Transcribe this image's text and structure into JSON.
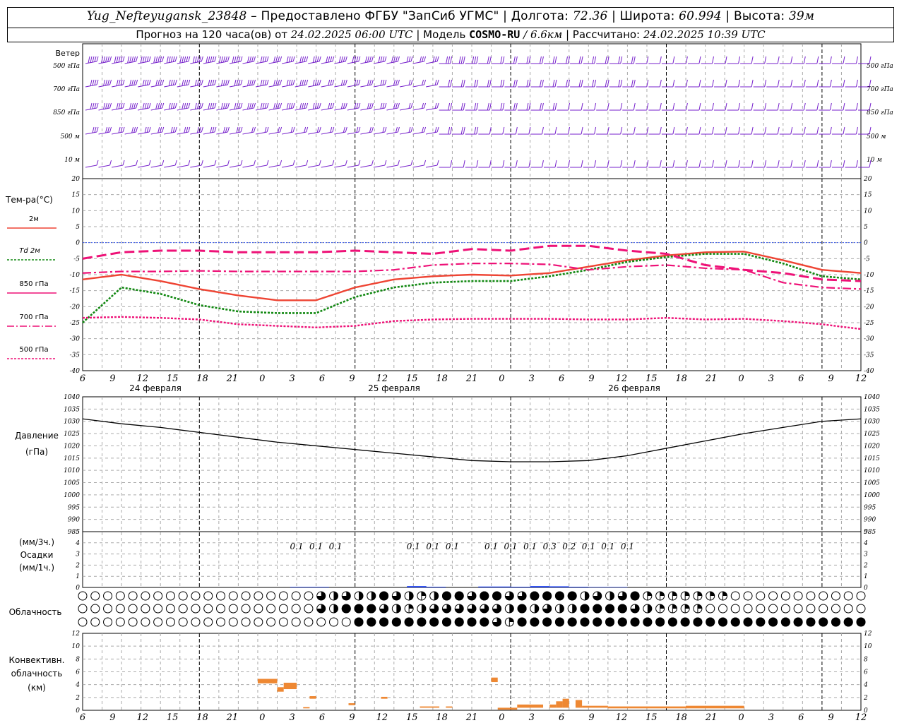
{
  "header": {
    "station": "Yug_Nefteyugansk_23848",
    "dash": " – ",
    "provided": "Предоставлено ФГБУ \"ЗапСиб УГМС\"",
    "sep": " | ",
    "lon_label": "Долгота:",
    "lon": "72.36",
    "lat_label": "Широта:",
    "lat": "60.994",
    "alt_label": "Высота:",
    "alt": "39м",
    "forecast_label": "Прогноз на 120 часа(ов) от",
    "run": "24.02.2025 06:00 UTC",
    "model_label": "Модель",
    "model": "COSMO-RU",
    "resolution": "/ 6.6км",
    "calc_label": "Рассчитано:",
    "calc": "24.02.2025 10:39 UTC"
  },
  "time_axis": {
    "ticks": [
      "6",
      "9",
      "12",
      "15",
      "18",
      "21",
      "0",
      "3",
      "6",
      "9",
      "12",
      "15",
      "18",
      "21",
      "0",
      "3",
      "6",
      "9",
      "12",
      "15",
      "18",
      "21",
      "0",
      "3",
      "6",
      "9",
      "12"
    ],
    "dates": [
      "24 февраля",
      "25 февраля",
      "26 февраля"
    ]
  },
  "labels": {
    "wind_title": "Ветер",
    "wind_levels": [
      "500 гПа",
      "700 гПа",
      "850 гПа",
      "500 м",
      "10 м"
    ],
    "temp_title": "Тем-ра(°С)",
    "temp_legend": [
      "2м",
      "Td  2м",
      "850 гПа",
      "700 гПа",
      "500 гПа"
    ],
    "pres_title": "Давление",
    "pres_unit": "(гПа)",
    "precip_unit3": "(мм/3ч.)",
    "precip_title": "Осадки",
    "precip_unit1": "(мм/1ч.)",
    "cloud_title": "Облачность",
    "conv_title": "Конвективн.",
    "conv_title2": "облачность",
    "conv_unit": "(км)"
  },
  "colors": {
    "t2m": "#ee4433",
    "td2m": "#118811",
    "t850": "#ee1177",
    "t700": "#ee1177",
    "t500": "#ee1177",
    "wind": "#7722cc",
    "pressure": "#000000",
    "precip": "#2244ee",
    "conv": "#ee8833"
  },
  "chart_data": [
    {
      "type": "line",
      "title": "Тем-ра(°С)",
      "x_hours": [
        0,
        6,
        12,
        18,
        24,
        30,
        36,
        42,
        48,
        54,
        60,
        66,
        72,
        78,
        84,
        90,
        96,
        102,
        108,
        114,
        120
      ],
      "ylim": [
        -40,
        20
      ],
      "yticks": [
        20,
        15,
        10,
        5,
        0,
        -5,
        -10,
        -15,
        -20,
        -25,
        -30,
        -35,
        -40
      ],
      "series": [
        {
          "name": "2м",
          "values": [
            -11.5,
            -10,
            -12,
            -14.5,
            -16.5,
            -18,
            -18,
            -14,
            -11.5,
            -10.5,
            -10,
            -10.3,
            -9.5,
            -7.5,
            -5.5,
            -4,
            -3,
            -2.8,
            -5.5,
            -8.5,
            -9.5
          ]
        },
        {
          "name": "Td  2м",
          "values": [
            -25,
            -14,
            -16,
            -19.5,
            -21.5,
            -22,
            -22,
            -17,
            -14,
            -12.5,
            -12,
            -12,
            -10.5,
            -8.5,
            -6,
            -4.5,
            -3.5,
            -3.5,
            -6.5,
            -10.5,
            -11.5
          ]
        },
        {
          "name": "850 гПа",
          "values": [
            -5,
            -3,
            -2.5,
            -2.5,
            -3,
            -3,
            -3,
            -2.5,
            -3,
            -3.5,
            -2,
            -2.5,
            -1,
            -1,
            -2.5,
            -3.5,
            -7,
            -8.5,
            -9.5,
            -11.5,
            -12
          ]
        },
        {
          "name": "700 гПа",
          "values": [
            -9.5,
            -9,
            -9,
            -8.8,
            -9,
            -9,
            -9,
            -9,
            -8.5,
            -7,
            -6.5,
            -6.5,
            -6.8,
            -8.5,
            -7.5,
            -7,
            -8,
            -8.5,
            -12.5,
            -14,
            -14.5
          ]
        },
        {
          "name": "500 гПа",
          "values": [
            -23.5,
            -23.2,
            -23.5,
            -24,
            -25.5,
            -26,
            -26.5,
            -26,
            -24.5,
            -24,
            -23.8,
            -23.8,
            -23.8,
            -24,
            -24,
            -23.5,
            -24,
            -23.8,
            -24.5,
            -25.5,
            -27
          ]
        }
      ]
    },
    {
      "type": "line",
      "title": "Давление",
      "x_hours": [
        0,
        6,
        12,
        18,
        24,
        30,
        36,
        42,
        48,
        54,
        60,
        66,
        72,
        78,
        84,
        90,
        96,
        102,
        108,
        114,
        120
      ],
      "ylim": [
        985,
        1040
      ],
      "yticks": [
        1040,
        1035,
        1030,
        1025,
        1020,
        1015,
        1010,
        1005,
        1000,
        995,
        990,
        985
      ],
      "series": [
        {
          "name": "Давление",
          "values": [
            1031,
            1029,
            1027.5,
            1025.5,
            1023.5,
            1021.5,
            1020,
            1018.5,
            1017,
            1015.5,
            1014,
            1013.5,
            1013.5,
            1014,
            1016,
            1019,
            1022,
            1025,
            1027.5,
            1030,
            1031
          ]
        }
      ]
    },
    {
      "type": "bar",
      "title": "Осадки",
      "yticks": [
        5,
        4,
        3,
        2,
        1,
        0
      ],
      "ylim": [
        0,
        5
      ],
      "labels": [
        {
          "h": 33,
          "text": "0.1"
        },
        {
          "h": 36,
          "text": "0.1"
        },
        {
          "h": 39,
          "text": "0.1"
        },
        {
          "h": 51,
          "text": "0.1"
        },
        {
          "h": 54,
          "text": "0.1"
        },
        {
          "h": 57,
          "text": "0.1"
        },
        {
          "h": 63,
          "text": "0.1"
        },
        {
          "h": 66,
          "text": "0.1"
        },
        {
          "h": 69,
          "text": "0.1"
        },
        {
          "h": 72,
          "text": "0.3"
        },
        {
          "h": 75,
          "text": "0.2"
        },
        {
          "h": 78,
          "text": "0.1"
        },
        {
          "h": 81,
          "text": "0.1"
        },
        {
          "h": 84,
          "text": "0.1"
        }
      ],
      "bars": [
        {
          "h0": 32,
          "h1": 35,
          "v": 0.05
        },
        {
          "h0": 35,
          "h1": 38,
          "v": 0.05
        },
        {
          "h0": 50,
          "h1": 53,
          "v": 0.12
        },
        {
          "h0": 53,
          "h1": 56,
          "v": 0.06
        },
        {
          "h0": 61,
          "h1": 66,
          "v": 0.08
        },
        {
          "h0": 66,
          "h1": 69,
          "v": 0.06
        },
        {
          "h0": 69,
          "h1": 72,
          "v": 0.12
        },
        {
          "h0": 72,
          "h1": 75,
          "v": 0.1
        },
        {
          "h0": 75,
          "h1": 78,
          "v": 0.06
        },
        {
          "h0": 78,
          "h1": 84,
          "v": 0.04
        }
      ]
    },
    {
      "type": "bar",
      "title": "Конвективн. облачность",
      "ylim": [
        0,
        12
      ],
      "yticks": [
        12,
        10,
        8,
        6,
        4,
        2,
        0
      ],
      "bars": [
        {
          "h0": 27,
          "h1": 30,
          "bot": 4.2,
          "top": 4.9
        },
        {
          "h0": 30,
          "h1": 31,
          "bot": 2.9,
          "top": 3.6
        },
        {
          "h0": 31,
          "h1": 33,
          "bot": 3.3,
          "top": 4.3
        },
        {
          "h0": 34,
          "h1": 35,
          "bot": 0.3,
          "top": 0.5
        },
        {
          "h0": 35,
          "h1": 36,
          "bot": 1.8,
          "top": 2.2
        },
        {
          "h0": 41,
          "h1": 42,
          "bot": 0.8,
          "top": 1.1
        },
        {
          "h0": 46,
          "h1": 47,
          "bot": 1.8,
          "top": 2.1
        },
        {
          "h0": 52,
          "h1": 55,
          "bot": 0.4,
          "top": 0.6
        },
        {
          "h0": 56,
          "h1": 57,
          "bot": 0.4,
          "top": 0.6
        },
        {
          "h0": 63,
          "h1": 64,
          "bot": 4.4,
          "top": 5.1
        },
        {
          "h0": 64,
          "h1": 67,
          "bot": 0.1,
          "top": 0.4
        },
        {
          "h0": 67,
          "h1": 71,
          "bot": 0.4,
          "top": 0.9
        },
        {
          "h0": 72,
          "h1": 73,
          "bot": 0.4,
          "top": 0.9
        },
        {
          "h0": 73,
          "h1": 74,
          "bot": 0.4,
          "top": 1.4
        },
        {
          "h0": 74,
          "h1": 75,
          "bot": 0.4,
          "top": 1.8
        },
        {
          "h0": 76,
          "h1": 77,
          "bot": 0.4,
          "top": 1.6
        },
        {
          "h0": 77,
          "h1": 81,
          "bot": 0.4,
          "top": 0.7
        },
        {
          "h0": 81,
          "h1": 93,
          "bot": 0.3,
          "top": 0.6
        },
        {
          "h0": 93,
          "h1": 102,
          "bot": 0.3,
          "top": 0.7
        }
      ]
    }
  ],
  "wind_barbs": {
    "note_levels": [
      "500 гПа",
      "700 гПа",
      "850 гПа",
      "500 м",
      "10 м"
    ],
    "speed_profile_ms": [
      [
        25,
        25,
        22,
        18,
        14,
        10,
        8,
        7,
        6,
        5
      ],
      [
        22,
        22,
        20,
        15,
        12,
        10,
        8,
        7,
        5,
        5
      ],
      [
        20,
        20,
        18,
        14,
        10,
        8,
        6,
        5,
        4,
        4
      ],
      [
        14,
        14,
        12,
        10,
        8,
        6,
        4,
        3,
        3,
        3
      ],
      [
        6,
        6,
        5,
        5,
        4,
        3,
        3,
        2,
        2,
        2
      ]
    ]
  },
  "cloud_rows": {
    "count": 52,
    "rows": [
      [
        0,
        0,
        0,
        0,
        0,
        0,
        0,
        0,
        0,
        0,
        0,
        0,
        0,
        0,
        0,
        0,
        0,
        0,
        0,
        3,
        2,
        3,
        2,
        2,
        4,
        3,
        2,
        1,
        2,
        4,
        4,
        3,
        4,
        4,
        3,
        3,
        4,
        4,
        4,
        4,
        2,
        3,
        2,
        3,
        4,
        1,
        1,
        1,
        1,
        1,
        1,
        1,
        0,
        0,
        0,
        0,
        0,
        0,
        0,
        0,
        0,
        0,
        0
      ],
      [
        0,
        0,
        0,
        0,
        0,
        0,
        0,
        0,
        0,
        0,
        0,
        0,
        0,
        0,
        0,
        0,
        0,
        0,
        0,
        3,
        2,
        4,
        4,
        4,
        3,
        2,
        1,
        2,
        3,
        3,
        3,
        3,
        3,
        3,
        2,
        4,
        2,
        3,
        2,
        2,
        4,
        4,
        4,
        4,
        3,
        2,
        1,
        1,
        1,
        1,
        0,
        0,
        0,
        0,
        0,
        0,
        0,
        0,
        0,
        0,
        0,
        0,
        0
      ],
      [
        0,
        0,
        0,
        0,
        0,
        0,
        0,
        0,
        0,
        0,
        0,
        0,
        0,
        0,
        0,
        0,
        0,
        0,
        0,
        0,
        0,
        0,
        4,
        4,
        4,
        4,
        4,
        4,
        4,
        4,
        4,
        4,
        4,
        3,
        1,
        4,
        4,
        4,
        4,
        4,
        4,
        4,
        4,
        4,
        4,
        4,
        4,
        4,
        4,
        4,
        4,
        4,
        4,
        4,
        4,
        4,
        4,
        4,
        4,
        4,
        4,
        4,
        4
      ]
    ]
  }
}
